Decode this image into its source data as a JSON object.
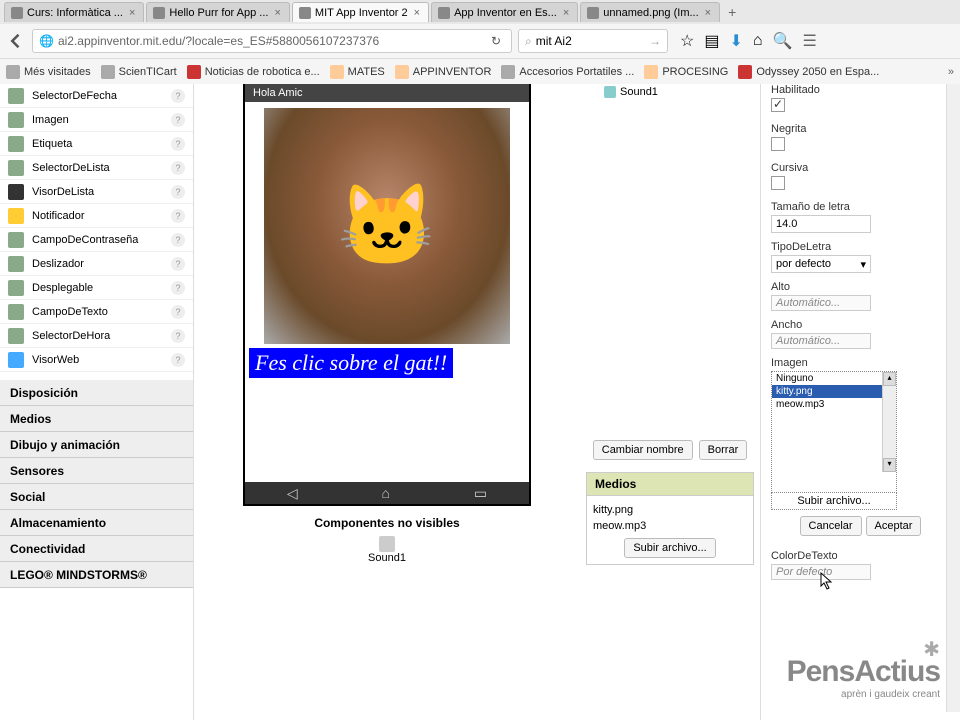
{
  "browser": {
    "tabs": [
      {
        "label": "Curs: Informàtica ..."
      },
      {
        "label": "Hello Purr for App ..."
      },
      {
        "label": "MIT App Inventor 2"
      },
      {
        "label": "App Inventor en Es..."
      },
      {
        "label": "unnamed.png (Im..."
      }
    ],
    "url": "ai2.appinventor.mit.edu/?locale=es_ES#5880056107237376",
    "search": "mit Ai2",
    "bookmarks": [
      "Més visitades",
      "ScienTICart",
      "Noticias de robotica e...",
      "MATES",
      "APPINVENTOR",
      "Accesorios Portatiles ...",
      "PROCESING",
      "Odyssey 2050 en Espa..."
    ]
  },
  "palette": {
    "items": [
      "SelectorDeFecha",
      "Imagen",
      "Etiqueta",
      "SelectorDeLista",
      "VisorDeLista",
      "Notificador",
      "CampoDeContraseña",
      "Deslizador",
      "Desplegable",
      "CampoDeTexto",
      "SelectorDeHora",
      "VisorWeb"
    ],
    "categories": [
      "Disposición",
      "Medios",
      "Dibujo y animación",
      "Sensores",
      "Social",
      "Almacenamiento",
      "Conectividad",
      "LEGO® MINDSTORMS®"
    ]
  },
  "viewer": {
    "phone_title": "Hola Amic",
    "caption": "Fes clic sobre el gat!!",
    "nonvisible_title": "Componentes no visibles",
    "sound_label": "Sound1"
  },
  "components": {
    "tree_item": "Sound1",
    "rename_btn": "Cambiar nombre",
    "delete_btn": "Borrar",
    "media_header": "Medios",
    "media_items": [
      "kitty.png",
      "meow.mp3"
    ],
    "media_upload": "Subir archivo..."
  },
  "properties": {
    "enabled": {
      "label": "Habilitado",
      "checked": true
    },
    "bold": {
      "label": "Negrita",
      "checked": false
    },
    "italic": {
      "label": "Cursiva",
      "checked": false
    },
    "fontsize": {
      "label": "Tamaño de letra",
      "value": "14.0"
    },
    "typeface": {
      "label": "TipoDeLetra",
      "value": "por defecto"
    },
    "height": {
      "label": "Alto",
      "value": "Automático..."
    },
    "width": {
      "label": "Ancho",
      "value": "Automático..."
    },
    "image": {
      "label": "Imagen",
      "options": [
        "Ninguno",
        "kitty.png",
        "meow.mp3"
      ],
      "selected_index": 1,
      "upload": "Subir archivo...",
      "cancel": "Cancelar",
      "ok": "Aceptar"
    },
    "textcolor": {
      "label": "ColorDeTexto",
      "value": "Por defecto"
    }
  },
  "watermark": {
    "main": "PensActius",
    "sub": "aprèn i gaudeix creant"
  }
}
